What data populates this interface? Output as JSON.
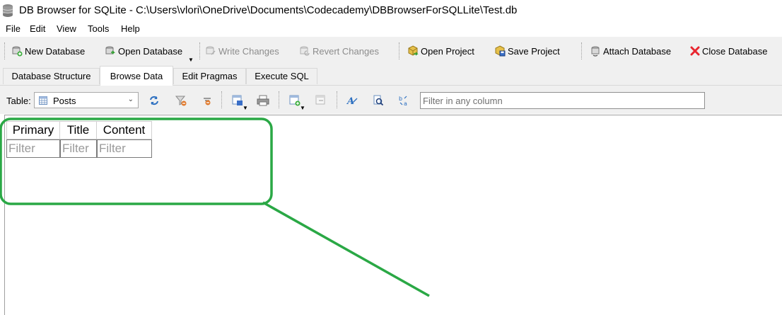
{
  "window": {
    "title": "DB Browser for SQLite - C:\\Users\\vlori\\OneDrive\\Documents\\Codecademy\\DBBrowserForSQLLite\\Test.db"
  },
  "menu": [
    "File",
    "Edit",
    "View",
    "Tools",
    "Help"
  ],
  "toolbar": {
    "new_database": "New Database",
    "open_database": "Open Database",
    "write_changes": "Write Changes",
    "revert_changes": "Revert Changes",
    "open_project": "Open Project",
    "save_project": "Save Project",
    "attach_database": "Attach Database",
    "close_database": "Close Database"
  },
  "tabs": [
    "Database Structure",
    "Browse Data",
    "Edit Pragmas",
    "Execute SQL"
  ],
  "active_tab": "Browse Data",
  "browse": {
    "table_label": "Table:",
    "selected_table": "Posts",
    "filter_placeholder": "Filter in any column"
  },
  "grid": {
    "columns": [
      "Primary",
      "Title",
      "Content"
    ],
    "filter_placeholder": "Filter"
  },
  "colors": {
    "annotation": "#2aa845",
    "close_icon": "#e8262f",
    "toolbar_bg": "#f0f0f0"
  }
}
